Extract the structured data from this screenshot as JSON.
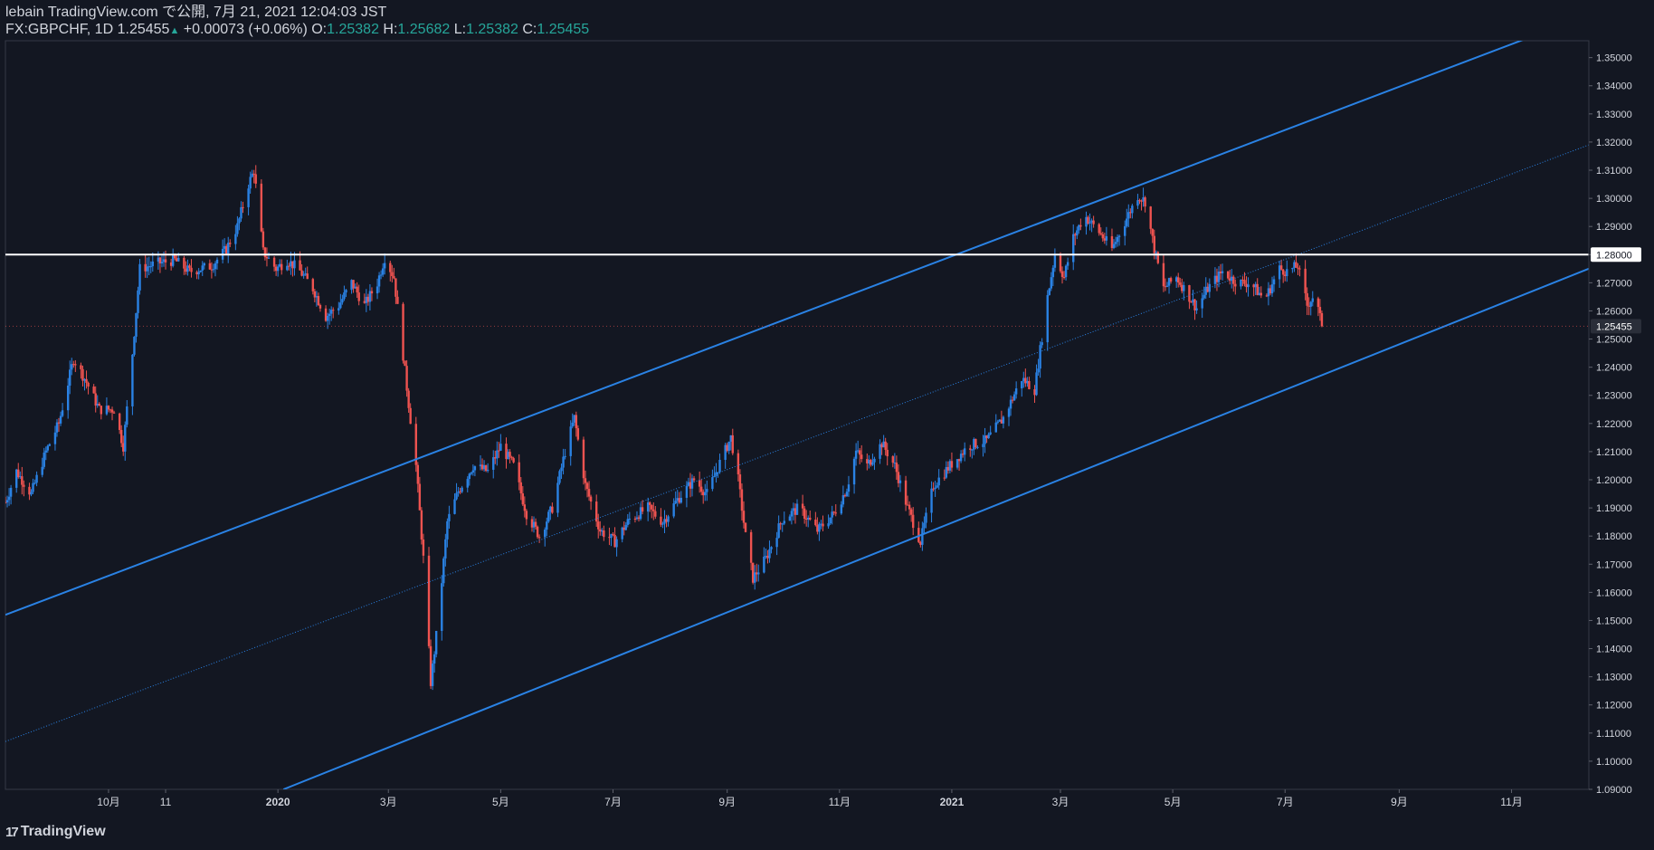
{
  "header": {
    "published": "lebain TradingView.com で公開, 7月 21, 2021 12:04:03 JST",
    "symbol": "FX:GBPCHF, 1D",
    "last": "1.25455",
    "change": "+0.00073 (+0.06%)",
    "o_label": "O:",
    "o_value": "1.25382",
    "h_label": "H:",
    "h_value": "1.25682",
    "l_label": "L:",
    "l_value": "1.25382",
    "c_label": "C:",
    "c_value": "1.25455"
  },
  "footer": {
    "logo_text": "TradingView"
  },
  "colors": {
    "background": "#131722",
    "up": "#2a82e4",
    "down": "#ef5350",
    "channel": "#2a82e4",
    "level": "#ffffff",
    "grid_text": "#d1d4dc"
  },
  "chart_data": {
    "type": "candlestick",
    "symbol": "FX:GBPCHF",
    "timeframe": "1D",
    "ylim": [
      1.09,
      1.356
    ],
    "y_ticks": [
      "1.09000",
      "1.10000",
      "1.11000",
      "1.12000",
      "1.13000",
      "1.14000",
      "1.15000",
      "1.16000",
      "1.17000",
      "1.18000",
      "1.19000",
      "1.20000",
      "1.21000",
      "1.22000",
      "1.23000",
      "1.24000",
      "1.25000",
      "1.26000",
      "1.27000",
      "1.28000",
      "1.29000",
      "1.30000",
      "1.31000",
      "1.32000",
      "1.33000",
      "1.34000",
      "1.35000"
    ],
    "x_ticks": [
      {
        "label": "10月",
        "date": "2019-10-01"
      },
      {
        "label": "11",
        "date": "2019-11-01"
      },
      {
        "label": "2020",
        "date": "2020-01-01"
      },
      {
        "label": "3月",
        "date": "2020-03-01"
      },
      {
        "label": "5月",
        "date": "2020-05-01"
      },
      {
        "label": "7月",
        "date": "2020-07-01"
      },
      {
        "label": "9月",
        "date": "2020-09-01"
      },
      {
        "label": "11月",
        "date": "2020-11-01"
      },
      {
        "label": "2021",
        "date": "2021-01-01"
      },
      {
        "label": "3月",
        "date": "2021-03-01"
      },
      {
        "label": "5月",
        "date": "2021-05-01"
      },
      {
        "label": "7月",
        "date": "2021-07-01"
      },
      {
        "label": "9月",
        "date": "2021-09-01"
      },
      {
        "label": "11月",
        "date": "2021-11-01"
      }
    ],
    "x_range": [
      "2019-08-06",
      "2021-12-13"
    ],
    "price_anchors": [
      [
        "2019-08-06",
        1.192
      ],
      [
        "2019-08-12",
        1.203
      ],
      [
        "2019-08-20",
        1.195
      ],
      [
        "2019-08-28",
        1.21
      ],
      [
        "2019-09-04",
        1.22
      ],
      [
        "2019-09-12",
        1.243
      ],
      [
        "2019-09-18",
        1.236
      ],
      [
        "2019-09-26",
        1.225
      ],
      [
        "2019-10-04",
        1.225
      ],
      [
        "2019-10-09",
        1.212
      ],
      [
        "2019-10-14",
        1.245
      ],
      [
        "2019-10-18",
        1.275
      ],
      [
        "2019-10-28",
        1.277
      ],
      [
        "2019-11-06",
        1.278
      ],
      [
        "2019-11-14",
        1.274
      ],
      [
        "2019-11-26",
        1.276
      ],
      [
        "2019-12-04",
        1.282
      ],
      [
        "2019-12-10",
        1.29
      ],
      [
        "2019-12-16",
        1.305
      ],
      [
        "2019-12-19",
        1.31
      ],
      [
        "2019-12-24",
        1.281
      ],
      [
        "2019-12-31",
        1.275
      ],
      [
        "2020-01-06",
        1.278
      ],
      [
        "2020-01-12",
        1.275
      ],
      [
        "2020-01-20",
        1.268
      ],
      [
        "2020-01-27",
        1.258
      ],
      [
        "2020-02-03",
        1.262
      ],
      [
        "2020-02-10",
        1.27
      ],
      [
        "2020-02-17",
        1.262
      ],
      [
        "2020-02-24",
        1.27
      ],
      [
        "2020-02-28",
        1.279
      ],
      [
        "2020-03-04",
        1.272
      ],
      [
        "2020-03-08",
        1.25
      ],
      [
        "2020-03-12",
        1.227
      ],
      [
        "2020-03-16",
        1.205
      ],
      [
        "2020-03-20",
        1.172
      ],
      [
        "2020-03-24",
        1.128
      ],
      [
        "2020-03-28",
        1.15
      ],
      [
        "2020-04-02",
        1.185
      ],
      [
        "2020-04-08",
        1.196
      ],
      [
        "2020-04-16",
        1.205
      ],
      [
        "2020-04-24",
        1.203
      ],
      [
        "2020-05-01",
        1.212
      ],
      [
        "2020-05-08",
        1.205
      ],
      [
        "2020-05-15",
        1.188
      ],
      [
        "2020-05-22",
        1.18
      ],
      [
        "2020-05-29",
        1.19
      ],
      [
        "2020-06-05",
        1.21
      ],
      [
        "2020-06-10",
        1.222
      ],
      [
        "2020-06-16",
        1.198
      ],
      [
        "2020-06-24",
        1.182
      ],
      [
        "2020-07-02",
        1.178
      ],
      [
        "2020-07-10",
        1.186
      ],
      [
        "2020-07-20",
        1.19
      ],
      [
        "2020-07-28",
        1.185
      ],
      [
        "2020-08-05",
        1.193
      ],
      [
        "2020-08-14",
        1.2
      ],
      [
        "2020-08-21",
        1.195
      ],
      [
        "2020-08-28",
        1.206
      ],
      [
        "2020-09-03",
        1.215
      ],
      [
        "2020-09-07",
        1.2
      ],
      [
        "2020-09-11",
        1.18
      ],
      [
        "2020-09-15",
        1.165
      ],
      [
        "2020-09-22",
        1.172
      ],
      [
        "2020-10-01",
        1.186
      ],
      [
        "2020-10-10",
        1.19
      ],
      [
        "2020-10-20",
        1.182
      ],
      [
        "2020-10-29",
        1.188
      ],
      [
        "2020-11-05",
        1.197
      ],
      [
        "2020-11-10",
        1.21
      ],
      [
        "2020-11-16",
        1.205
      ],
      [
        "2020-11-24",
        1.213
      ],
      [
        "2020-12-01",
        1.205
      ],
      [
        "2020-12-08",
        1.19
      ],
      [
        "2020-12-15",
        1.178
      ],
      [
        "2020-12-22",
        1.198
      ],
      [
        "2020-12-31",
        1.205
      ],
      [
        "2021-01-10",
        1.212
      ],
      [
        "2021-01-20",
        1.214
      ],
      [
        "2021-01-29",
        1.222
      ],
      [
        "2021-02-08",
        1.236
      ],
      [
        "2021-02-15",
        1.232
      ],
      [
        "2021-02-22",
        1.265
      ],
      [
        "2021-02-26",
        1.28
      ],
      [
        "2021-03-03",
        1.272
      ],
      [
        "2021-03-08",
        1.286
      ],
      [
        "2021-03-14",
        1.294
      ],
      [
        "2021-03-22",
        1.288
      ],
      [
        "2021-03-29",
        1.282
      ],
      [
        "2021-04-06",
        1.293
      ],
      [
        "2021-04-12",
        1.301
      ],
      [
        "2021-04-16",
        1.299
      ],
      [
        "2021-04-21",
        1.282
      ],
      [
        "2021-04-26",
        1.268
      ],
      [
        "2021-05-03",
        1.272
      ],
      [
        "2021-05-10",
        1.265
      ],
      [
        "2021-05-14",
        1.261
      ],
      [
        "2021-05-20",
        1.268
      ],
      [
        "2021-05-28",
        1.274
      ],
      [
        "2021-06-05",
        1.27
      ],
      [
        "2021-06-12",
        1.27
      ],
      [
        "2021-06-20",
        1.264
      ],
      [
        "2021-06-28",
        1.275
      ],
      [
        "2021-07-02",
        1.274
      ],
      [
        "2021-07-08",
        1.276
      ],
      [
        "2021-07-13",
        1.262
      ],
      [
        "2021-07-17",
        1.266
      ],
      [
        "2021-07-21",
        1.2546
      ]
    ],
    "levels": [
      {
        "value": 1.28,
        "label": "1.28000"
      }
    ],
    "last_price": {
      "value": 1.25455,
      "label": "1.25455"
    },
    "channel": {
      "upper": [
        [
          "2019-08-06",
          1.152
        ],
        [
          "2021-11-10",
          1.357
        ]
      ],
      "mid": [
        [
          "2019-08-06",
          1.107
        ],
        [
          "2021-12-13",
          1.319
        ]
      ],
      "lower": [
        [
          "2020-01-04",
          1.09
        ],
        [
          "2021-12-13",
          1.275
        ]
      ]
    }
  }
}
